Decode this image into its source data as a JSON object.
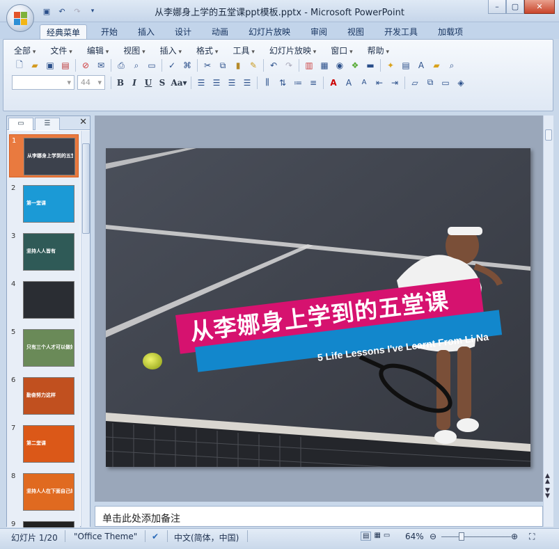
{
  "window": {
    "title": "从李娜身上学的五堂课ppt模板.pptx - Microsoft PowerPoint"
  },
  "qat": {
    "save_icon": "save-icon",
    "undo_icon": "undo-icon",
    "redo_icon": "redo-icon"
  },
  "tabs": [
    {
      "label": "经典菜单",
      "active": true
    },
    {
      "label": "开始"
    },
    {
      "label": "插入"
    },
    {
      "label": "设计"
    },
    {
      "label": "动画"
    },
    {
      "label": "幻灯片放映"
    },
    {
      "label": "审阅"
    },
    {
      "label": "视图"
    },
    {
      "label": "开发工具"
    },
    {
      "label": "加载项"
    }
  ],
  "menubar": [
    "全部",
    "文件",
    "编辑",
    "视图",
    "插入",
    "格式",
    "工具",
    "幻灯片放映",
    "窗口",
    "帮助"
  ],
  "font": {
    "name": "",
    "size": "44"
  },
  "slide": {
    "title": "从李娜身上学到的五堂课",
    "subtitle": "5 Life Lessons I've Learnt From Li Na",
    "title_bg": "#d6126f",
    "subtitle_bg": "#1287cc"
  },
  "thumbnails": [
    {
      "num": "1",
      "text": "从李娜身上学到的五堂课",
      "bg": "#3c414c"
    },
    {
      "num": "2",
      "text": "第一堂课",
      "bg": "#1b9ad6"
    },
    {
      "num": "3",
      "text": "坚持人人皆有",
      "bg": "#2f5a57"
    },
    {
      "num": "4",
      "text": "",
      "bg": "#2a2d33"
    },
    {
      "num": "5",
      "text": "只有三个人才可以做好自己的事情",
      "bg": "#6a8a58"
    },
    {
      "num": "6",
      "text": "勤奋努力这样",
      "bg": "#c1501f"
    },
    {
      "num": "7",
      "text": "第二堂课",
      "bg": "#db5818"
    },
    {
      "num": "8",
      "text": "坚持人人在下面自己的坚持",
      "bg": "#e06a20"
    },
    {
      "num": "9",
      "text": "",
      "bg": "#222"
    }
  ],
  "notes": {
    "placeholder": "单击此处添加备注"
  },
  "status": {
    "slide": "幻灯片 1/20",
    "theme": "\"Office Theme\"",
    "lang": "中文(简体，中国)",
    "zoom": "64%"
  }
}
